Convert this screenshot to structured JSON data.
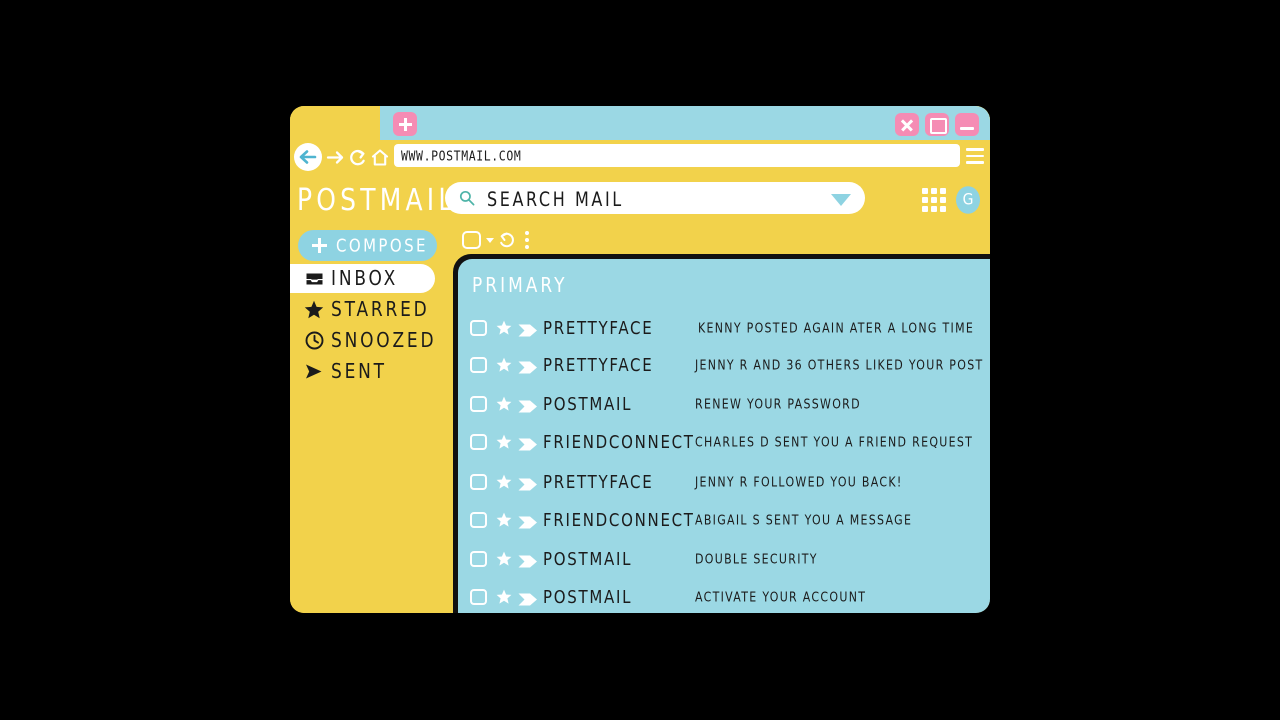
{
  "browser": {
    "tab_new_label": "+",
    "url": "WWW.POSTMAIL.COM",
    "nav": {
      "back_icon": "back-arrow-icon",
      "forward_icon": "forward-arrow-icon",
      "reload_icon": "reload-icon",
      "home_icon": "home-icon",
      "menu_icon": "hamburger-menu-icon"
    },
    "window_controls": {
      "close": "close-icon",
      "maximize": "maximize-icon",
      "minimize": "minimize-icon"
    }
  },
  "app": {
    "brand": "POSTMAIL",
    "search": {
      "placeholder": "SEARCH MAIL",
      "icon": "search-icon",
      "dropdown_icon": "chevron-down-icon"
    },
    "apps_grid_icon": "apps-grid-icon",
    "avatar_initial": "G"
  },
  "sidebar": {
    "compose_label": "COMPOSE",
    "items": [
      {
        "label": "INBOX",
        "icon": "inbox-tray-icon",
        "active": true
      },
      {
        "label": "STARRED",
        "icon": "star-icon",
        "active": false
      },
      {
        "label": "SNOOZED",
        "icon": "clock-icon",
        "active": false
      },
      {
        "label": "SENT",
        "icon": "send-arrow-icon",
        "active": false
      }
    ]
  },
  "list_toolbar": {
    "select_all_icon": "checkbox-icon",
    "select_all_caret_icon": "chevron-down-icon",
    "refresh_icon": "refresh-icon",
    "more_icon": "more-vertical-icon"
  },
  "mail": {
    "category": "PRIMARY",
    "rows": [
      {
        "sender": "PRETTYFACE",
        "subject": "KENNY POSTED AGAIN ATER A LONG TIME"
      },
      {
        "sender": "PRETTYFACE",
        "subject": "JENNY R  AND 36 OTHERS LIKED YOUR POST"
      },
      {
        "sender": "POSTMAIL",
        "subject": "RENEW YOUR PASSWORD"
      },
      {
        "sender": "FRIENDCONNECT",
        "subject": "CHARLES D  SENT YOU A FRIEND REQUEST"
      },
      {
        "sender": "PRETTYFACE",
        "subject": "JENNY R  FOLLOWED YOU BACK!"
      },
      {
        "sender": "FRIENDCONNECT",
        "subject": "ABIGAIL S SENT YOU A MESSAGE"
      },
      {
        "sender": "POSTMAIL",
        "subject": "DOUBLE SECURITY"
      },
      {
        "sender": "POSTMAIL",
        "subject": "ACTIVATE YOUR ACCOUNT"
      }
    ]
  },
  "colors": {
    "page_background": "#000000",
    "chrome_yellow": "#F2D24B",
    "panel_cyan": "#9BD8E4",
    "accent_cyan": "#8ED3E2",
    "window_button_pink": "#F58CB4",
    "text_dark": "#1B1B1B",
    "white": "#FFFFFF"
  }
}
